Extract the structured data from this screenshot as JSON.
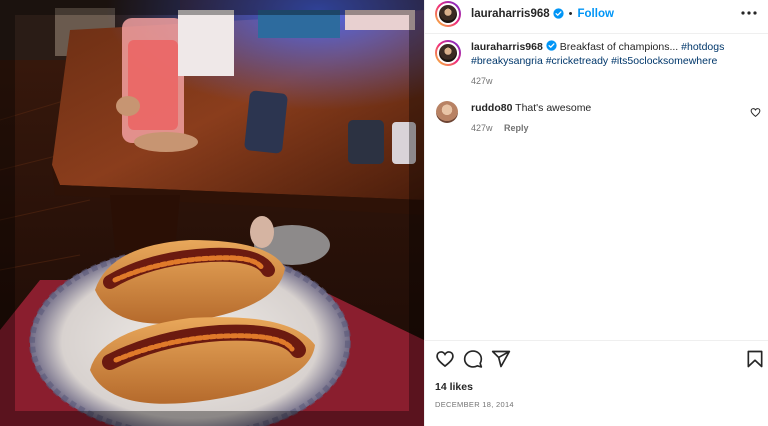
{
  "post": {
    "username": "lauraharris968",
    "follow_label": "Follow",
    "separator": "•",
    "caption_text": "Breakfast of champions...",
    "hashtags": [
      "#hotdogs",
      "#breakysangria",
      "#cricketready",
      "#its5oclocksomewhere"
    ],
    "caption_age": "427w"
  },
  "comments": [
    {
      "username": "ruddo80",
      "text": "That's awesome",
      "age": "427w",
      "reply_label": "Reply"
    }
  ],
  "engagement": {
    "likes": "14 likes",
    "date": "DECEMBER 18, 2014"
  },
  "icons": {
    "verified": "verified-badge-icon",
    "more": "more-options-icon",
    "like": "heart-icon",
    "comment": "comment-icon",
    "share": "share-icon",
    "save": "bookmark-icon"
  },
  "colors": {
    "link": "#0095f6",
    "hashtag": "#00376b",
    "muted": "#737373"
  }
}
